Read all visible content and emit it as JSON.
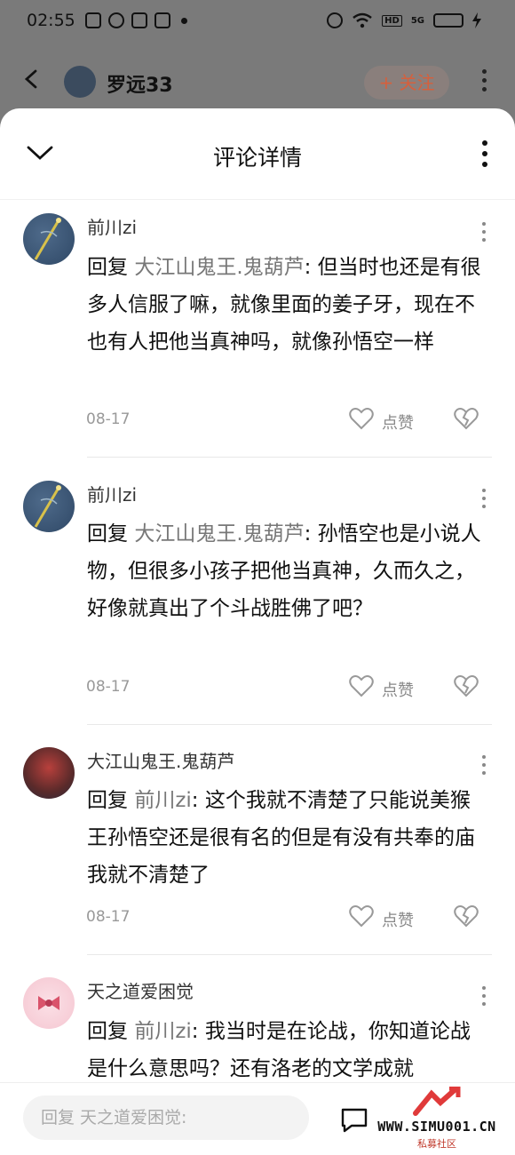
{
  "status_bar": {
    "time": "02:55",
    "hd": "HD",
    "net": "5G"
  },
  "nav": {
    "author_name": "罗远33",
    "follow_label": "+ 关注"
  },
  "sheet": {
    "title": "评论详情"
  },
  "comments": [
    {
      "username": "前川zi",
      "reply_prefix": "回复 ",
      "reply_to": "大江山鬼王.鬼葫芦",
      "text": ": 但当时也还是有很多人信服了嘛，就像里面的姜子牙，现在不也有人把他当真神吗，就像孙悟空一样",
      "date": "08-17",
      "like_label": "点赞"
    },
    {
      "username": "前川zi",
      "reply_prefix": "回复 ",
      "reply_to": "大江山鬼王.鬼葫芦",
      "text": ": 孙悟空也是小说人物，但很多小孩子把他当真神，久而久之，好像就真出了个斗战胜佛了吧？",
      "date": "08-17",
      "like_label": "点赞"
    },
    {
      "username": "大江山鬼王.鬼葫芦",
      "reply_prefix": "回复 ",
      "reply_to": "前川zi",
      "text": ": 这个我就不清楚了只能说美猴王孙悟空还是很有名的但是有没有共奉的庙我就不清楚了",
      "date": "08-17",
      "like_label": "点赞"
    },
    {
      "username": "天之道爱困觉",
      "reply_prefix": "回复 ",
      "reply_to": "前川zi",
      "text": ": 我当时是在论战，你知道论战是什么意思吗？还有洛老的文学成就"
    }
  ],
  "bottom": {
    "reply_placeholder": "回复 天之道爱困觉:"
  },
  "watermark": {
    "url": "WWW.SIMU001.CN",
    "caption": "私募社区"
  },
  "colors": {
    "accent": "#d5603d",
    "reply_target": "#777777",
    "watermark_red": "#c0392b"
  }
}
